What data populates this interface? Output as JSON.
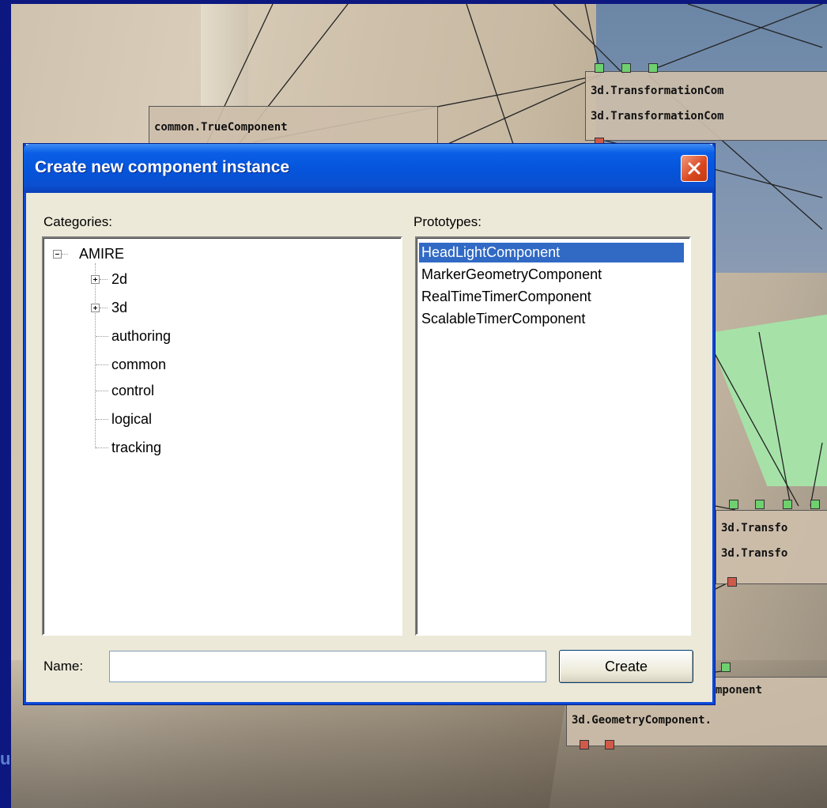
{
  "dialog": {
    "title": "Create new component instance",
    "categories_label": "Categories:",
    "prototypes_label": "Prototypes:",
    "name_label": "Name:",
    "name_value": "",
    "create_label": "Create"
  },
  "tree": {
    "root": "AMIRE",
    "items": [
      "2d",
      "3d",
      "authoring",
      "common",
      "control",
      "logical",
      "tracking"
    ]
  },
  "prototypes": {
    "items": [
      "HeadLightComponent",
      "MarkerGeometryComponent",
      "RealTimeTimerComponent",
      "ScalableTimerComponent"
    ],
    "selected": "HeadLightComponent"
  },
  "background": {
    "node_true": "common.TrueComponent",
    "node_transform_a1": "3d.TransformationCom",
    "node_transform_a2": "3d.TransformationCom",
    "node_transform_b1": "3d.Transfo",
    "node_transform_b2": "3d.Transfo",
    "node_geometry_1": "mponent",
    "node_geometry_2": "3d.GeometryComponent.",
    "footer_fragment": "u"
  },
  "colors": {
    "selection": "#316ac5",
    "titlebar": "#0555dc",
    "frame": "#0c1780"
  }
}
